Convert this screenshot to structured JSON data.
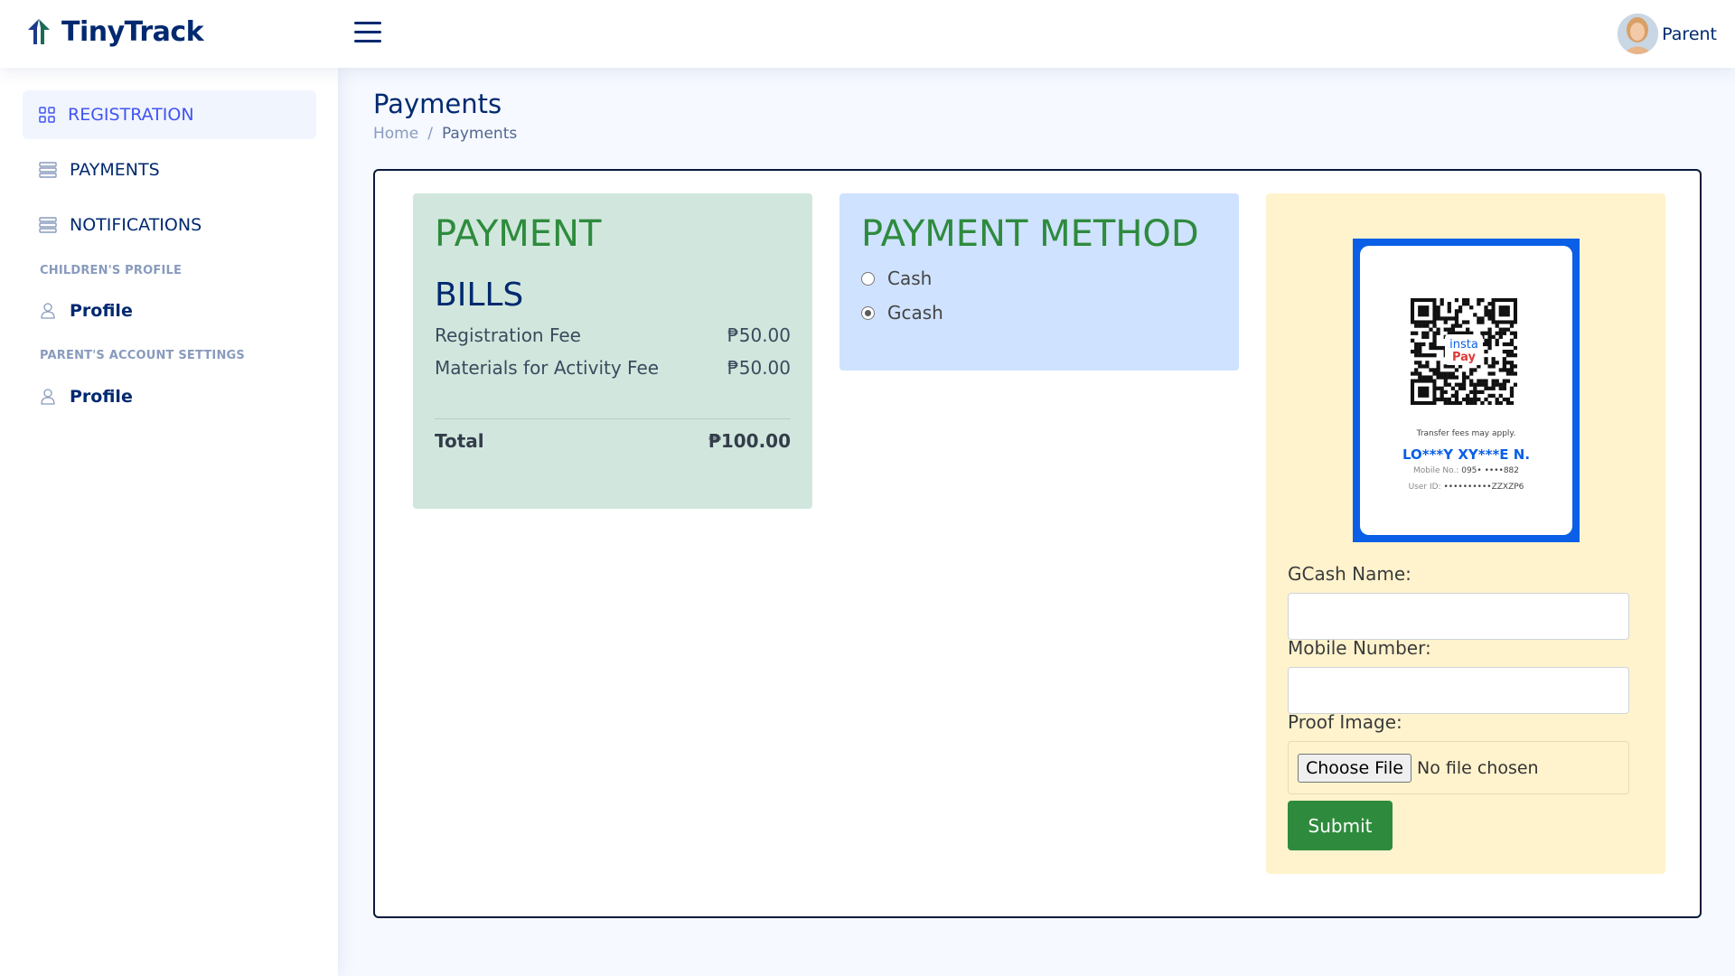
{
  "app": {
    "name": "TinyTrack",
    "user_name": "Parent"
  },
  "sidebar": {
    "items": [
      {
        "label": "REGISTRATION",
        "icon": "grid-icon",
        "active": true
      },
      {
        "label": "PAYMENTS",
        "icon": "layers-icon",
        "active": false
      },
      {
        "label": "NOTIFICATIONS",
        "icon": "layers-icon",
        "active": false
      }
    ],
    "children_heading": "CHILDREN'S PROFILE",
    "children_profile": "Profile",
    "parent_heading": "PARENT'S ACCOUNT SETTINGS",
    "parent_profile": "Profile"
  },
  "page": {
    "title": "Payments",
    "breadcrumb": {
      "home": "Home",
      "separator": "/",
      "current": "Payments"
    }
  },
  "payment_card": {
    "title": "PAYMENT",
    "subtitle": "BILLS",
    "bills": [
      {
        "name": "Registration Fee",
        "amount": "₱50.00"
      },
      {
        "name": "Materials for Activity Fee",
        "amount": "₱50.00"
      }
    ],
    "total_label": "Total",
    "total_amount": "₱100.00"
  },
  "method_card": {
    "title": "PAYMENT METHOD",
    "options": [
      {
        "label": "Cash",
        "checked": false
      },
      {
        "label": "Gcash",
        "checked": true
      }
    ]
  },
  "gcash_card": {
    "qr": {
      "note": "Transfer fees may apply.",
      "account_name": "LO***Y XY***E N.",
      "mobile_label": "Mobile No.:",
      "mobile_value": "095• ••••882",
      "user_label": "User ID:",
      "user_value": "••••••••••ZZXZP6",
      "logo_text_top": "insta",
      "logo_text_bottom": "Pay"
    },
    "name_label": "GCash Name:",
    "name_value": "",
    "mobile_label": "Mobile Number:",
    "mobile_value": "",
    "proof_label": "Proof Image:",
    "file_button": "Choose File",
    "file_status": "No file chosen",
    "submit_label": "Submit"
  },
  "colors": {
    "navy": "#012970",
    "accent": "#4154f1",
    "green": "#2e8b3d",
    "bills_bg": "#d1e7dd",
    "method_bg": "#cfe2ff",
    "gcash_bg": "#fff3cd",
    "qr_blue": "#0a5fe6"
  }
}
